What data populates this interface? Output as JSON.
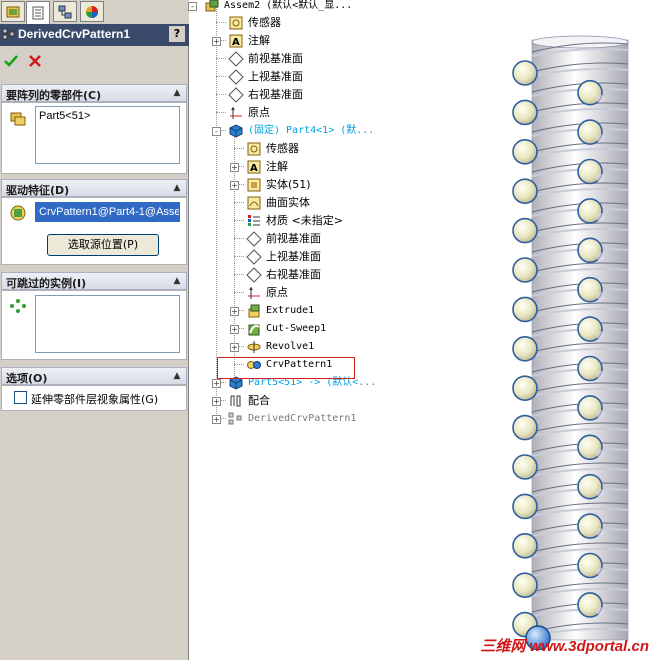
{
  "property_manager": {
    "title": "DerivedCrvPattern1",
    "help_label": "?",
    "ok_icon": "check-icon",
    "cancel_icon": "close-icon",
    "sections": {
      "components": {
        "label": "要阵列的零部件(C)",
        "items": [
          "Part5<51>"
        ]
      },
      "driving": {
        "label": "驱动特征(D)",
        "value": "CrvPattern1@Part4-1@Asse",
        "button": "选取源位置(P)"
      },
      "skip": {
        "label": "可跳过的实例(I)"
      },
      "options": {
        "label": "选项(O)",
        "checkbox_label": "延伸零部件层视象属性(G)",
        "checked": false
      }
    }
  },
  "tree": {
    "nodes": [
      {
        "label": "Assem2  (默认<默认_显...",
        "icon": "assembly-icon"
      },
      {
        "label": "传感器",
        "icon": "sensor-icon"
      },
      {
        "label": "注解",
        "icon": "annotation-icon"
      },
      {
        "label": "前视基准面",
        "icon": "plane-icon"
      },
      {
        "label": "上视基准面",
        "icon": "plane-icon"
      },
      {
        "label": "右视基准面",
        "icon": "plane-icon"
      },
      {
        "label": "原点",
        "icon": "origin-icon"
      },
      {
        "label": "(固定) Part4<1> (默...",
        "icon": "part-icon"
      },
      {
        "label": "传感器",
        "icon": "sensor-icon"
      },
      {
        "label": "注解",
        "icon": "annotation-icon"
      },
      {
        "label": "实体(51)",
        "icon": "solid-bodies-icon"
      },
      {
        "label": "曲面实体",
        "icon": "surface-bodies-icon"
      },
      {
        "label": "材质 <未指定>",
        "icon": "material-icon"
      },
      {
        "label": "前视基准面",
        "icon": "plane-icon"
      },
      {
        "label": "上视基准面",
        "icon": "plane-icon"
      },
      {
        "label": "右视基准面",
        "icon": "plane-icon"
      },
      {
        "label": "原点",
        "icon": "origin-icon"
      },
      {
        "label": "Extrude1",
        "icon": "extrude-icon"
      },
      {
        "label": "Cut-Sweep1",
        "icon": "cut-sweep-icon"
      },
      {
        "label": "Revolve1",
        "icon": "revolve-icon"
      },
      {
        "label": "CrvPattern1",
        "icon": "curve-pattern-icon"
      },
      {
        "label": "Part5<51> -> (默认<...",
        "icon": "part-icon"
      },
      {
        "label": "配合",
        "icon": "mates-icon"
      },
      {
        "label": "DerivedCrvPattern1",
        "icon": "derived-pattern-icon"
      }
    ]
  },
  "watermark": "三维网 www.3dportal.cn",
  "colors": {
    "titlebar": "#3a4a6b",
    "fixed_part": "#00a0e0",
    "highlight": "#d02020"
  }
}
